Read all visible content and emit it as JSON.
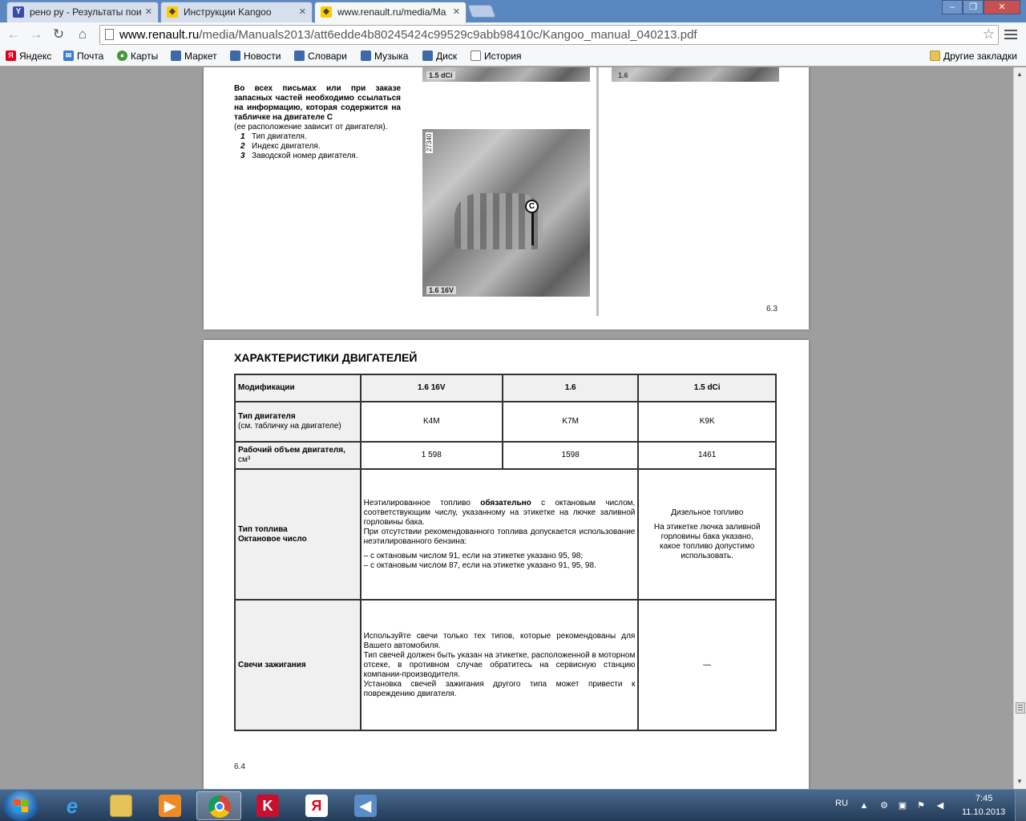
{
  "browser": {
    "tabs": [
      {
        "label": "рено ру - Результаты пои",
        "icon": "yandex-icon"
      },
      {
        "label": "Инструкции Kangoo",
        "icon": "renault-icon"
      },
      {
        "label": "www.renault.ru/media/Ma",
        "icon": "renault-icon"
      }
    ],
    "url_host": "www.renault.ru",
    "url_path": "/media/Manuals2013/att6edde4b80245424c99529c9abb98410c/Kangoo_manual_040213.pdf",
    "bookmarks": [
      "Яндекс",
      "Почта",
      "Карты",
      "Маркет",
      "Новости",
      "Словари",
      "Музыка",
      "Диск",
      "История"
    ],
    "other_bookmarks": "Другие закладки"
  },
  "page1": {
    "notice_bold": "Во всех письмах или при заказе запасных частей необходимо ссылаться на информацию, которая содержится на табличке на двигателе C",
    "notice_sub": "(ее расположение зависит от двигателя).",
    "items": [
      {
        "num": "1",
        "text": "Тип двигателя."
      },
      {
        "num": "2",
        "text": "Индекс двигателя."
      },
      {
        "num": "3",
        "text": "Заводской номер двигателя."
      }
    ],
    "photo_labels": [
      "1.5 dCi",
      "1.6",
      "1.6 16V"
    ],
    "photo_ref": "27340",
    "marker": "C",
    "page_number": "6.3"
  },
  "page2": {
    "title": "ХАРАКТЕРИСТИКИ ДВИГАТЕЛЕЙ",
    "page_number": "6.4",
    "table": {
      "header": [
        "Модификации",
        "1.6 16V",
        "1.6",
        "1.5 dCi"
      ],
      "engine_type_label": "Тип двигателя",
      "engine_type_sub": "(см. табличку на двигателе)",
      "engine_types": [
        "K4M",
        "K7M",
        "K9K"
      ],
      "displacement_label": "Рабочий объем двигателя,",
      "displacement_unit": "см³",
      "displacements": [
        "1 598",
        "1598",
        "1461"
      ],
      "fuel_label_1": "Тип топлива",
      "fuel_label_2": "Октановое число",
      "fuel_text_a": "Неэтилированное топливо ",
      "fuel_text_bold": "обязательно",
      "fuel_text_b": " с октановым числом, соответствующим числу, указанному на этикетке на лючке заливной горловины бака.",
      "fuel_text_c": "При отсутствии рекомендованного топлива допускается использование неэтилированного бензина:",
      "fuel_list": [
        "–   с октановым числом 91, если на этикетке указано 95, 98;",
        "–   с октановым числом 87, если на этикетке указано 91, 95, 98."
      ],
      "diesel_1": "Дизельное топливо",
      "diesel_2": "На этикетке лючка заливной горловины бака указано, какое топливо допустимо использовать.",
      "plugs_label": "Свечи зажигания",
      "plugs_text_1": "Используйте свечи только тех типов, которые рекомендованы для Вашего автомобиля.",
      "plugs_text_2": "Тип свечей должен быть указан на этикетке, расположенной в моторном отсеке, в противном случае обратитесь на сервисную станцию компании-производителя.",
      "plugs_text_3": "Установка свечей зажигания другого типа может привести к повреждению двигателя.",
      "plugs_diesel": "—"
    }
  },
  "taskbar": {
    "lang": "RU",
    "time": "7:45",
    "date": "11.10.2013"
  }
}
